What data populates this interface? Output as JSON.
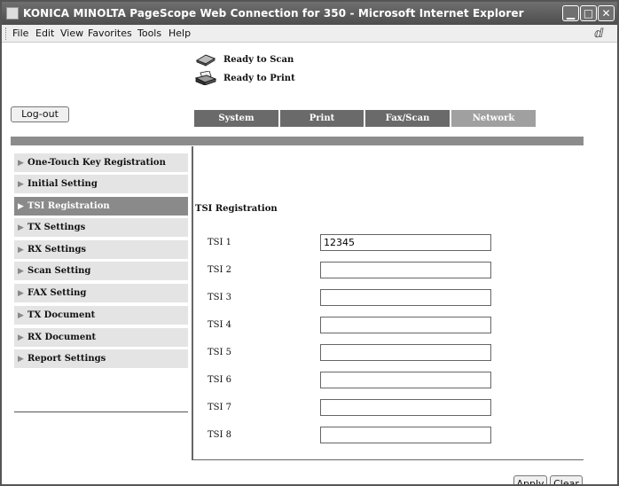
{
  "window": {
    "title": "KONICA MINOLTA PageScope Web Connection for 350 - Microsoft Internet Explorer",
    "minimize": "▁",
    "maximize": "□",
    "close": "✕"
  },
  "menubar": {
    "items": [
      "File",
      "Edit",
      "View",
      "Favorites",
      "Tools",
      "Help"
    ]
  },
  "status": {
    "scan": "Ready to Scan",
    "print": "Ready to Print",
    "scan_icon": "scanner-icon",
    "print_icon": "printer-icon"
  },
  "logout_label": "Log-out",
  "tabs": [
    {
      "label": "System",
      "color": "#6a6a6a"
    },
    {
      "label": "Print",
      "color": "#6a6a6a"
    },
    {
      "label": "Fax/Scan",
      "color": "#6a6a6a"
    },
    {
      "label": "Network",
      "color": "#a0a0a0"
    }
  ],
  "sidebar": {
    "items": [
      {
        "label": "One-Touch Key Registration",
        "active": false
      },
      {
        "label": "Initial Setting",
        "active": false
      },
      {
        "label": "TSI Registration",
        "active": true
      },
      {
        "label": "TX Settings",
        "active": false
      },
      {
        "label": "RX Settings",
        "active": false
      },
      {
        "label": "Scan Setting",
        "active": false
      },
      {
        "label": "FAX Setting",
        "active": false
      },
      {
        "label": "TX Document",
        "active": false
      },
      {
        "label": "RX Document",
        "active": false
      },
      {
        "label": "Report Settings",
        "active": false
      }
    ]
  },
  "form": {
    "title": "TSI Registration",
    "fields": [
      {
        "label": "TSI 1",
        "value": "12345"
      },
      {
        "label": "TSI 2",
        "value": ""
      },
      {
        "label": "TSI 3",
        "value": ""
      },
      {
        "label": "TSI 4",
        "value": ""
      },
      {
        "label": "TSI 5",
        "value": ""
      },
      {
        "label": "TSI 6",
        "value": ""
      },
      {
        "label": "TSI 7",
        "value": ""
      },
      {
        "label": "TSI 8",
        "value": ""
      }
    ]
  },
  "buttons": {
    "apply": "Apply",
    "clear": "Clear"
  }
}
